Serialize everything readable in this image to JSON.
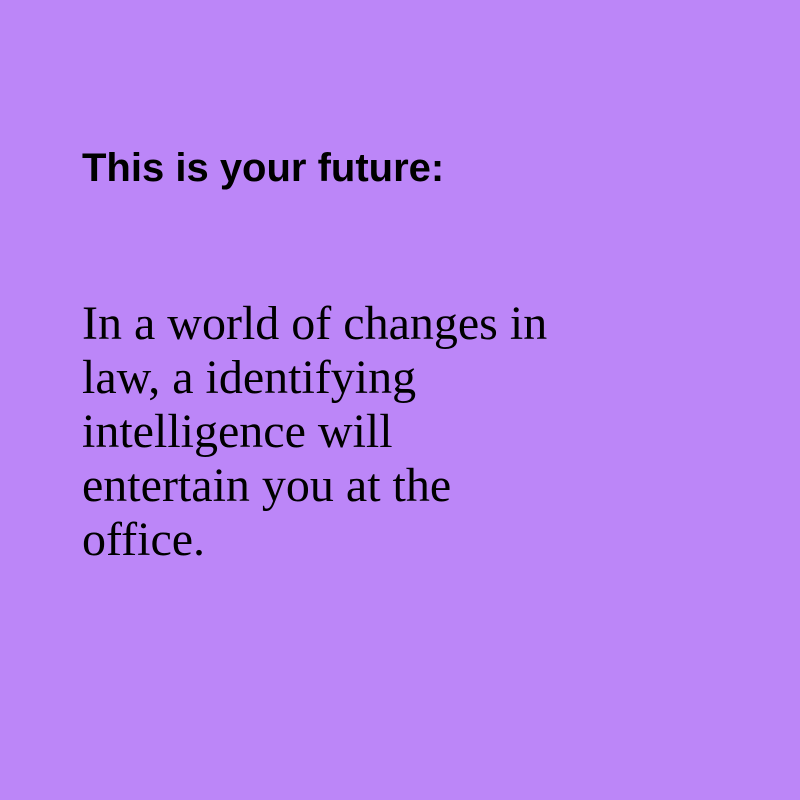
{
  "background_color": "#bc86f8",
  "text_color": "#000000",
  "heading": "This is your future:",
  "body_lines": [
    "In a world of changes in",
    "law, a identifying",
    "intelligence will",
    "entertain you at the",
    "office."
  ]
}
